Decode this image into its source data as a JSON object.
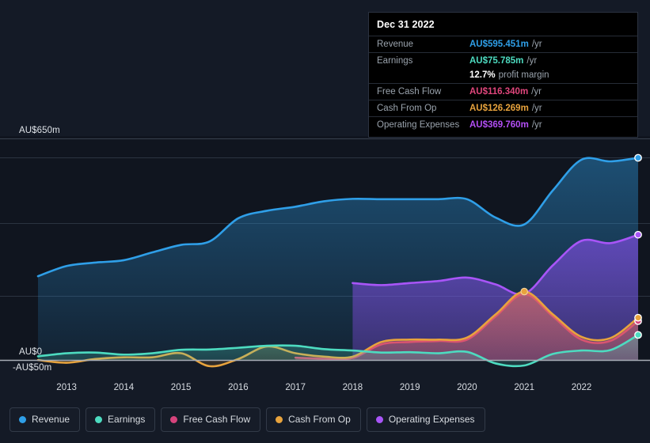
{
  "axis": {
    "top_label": "AU$650m",
    "zero_label": "AU$0",
    "negative_label": "-AU$50m",
    "years": [
      "2013",
      "2014",
      "2015",
      "2016",
      "2017",
      "2018",
      "2019",
      "2020",
      "2021",
      "2022"
    ]
  },
  "tooltip": {
    "date": "Dec 31 2022",
    "unit": "/yr",
    "rows": [
      {
        "key": "Revenue",
        "value": "AU$595.451m",
        "color": "#2f9fe8"
      },
      {
        "key": "Earnings",
        "value": "AU$75.785m",
        "color": "#4ddbc0"
      },
      {
        "key": "Free Cash Flow",
        "value": "AU$116.340m",
        "color": "#e0467c"
      },
      {
        "key": "Cash From Op",
        "value": "AU$126.269m",
        "color": "#e8a33d"
      },
      {
        "key": "Operating Expenses",
        "value": "AU$369.760m",
        "color": "#b34ef5"
      }
    ],
    "profit_margin_value": "12.7%",
    "profit_margin_label": "profit margin"
  },
  "legend": {
    "items": [
      {
        "label": "Revenue",
        "color": "#2f9fe8"
      },
      {
        "label": "Earnings",
        "color": "#4ddbc0"
      },
      {
        "label": "Free Cash Flow",
        "color": "#d6437c"
      },
      {
        "label": "Cash From Op",
        "color": "#e8a33d"
      },
      {
        "label": "Operating Expenses",
        "color": "#a855f7"
      }
    ]
  },
  "chart_data": {
    "type": "area",
    "title": "",
    "xlabel": "",
    "ylabel": "AU$",
    "ylim": [
      -50,
      650
    ],
    "grid": true,
    "legend_position": "bottom",
    "x_tick_labels": [
      "2013",
      "2014",
      "2015",
      "2016",
      "2017",
      "2018",
      "2019",
      "2020",
      "2021",
      "2022"
    ],
    "y_tick_labels": [
      "AU$650m",
      "AU$0",
      "-AU$50m"
    ],
    "currency": "AU$",
    "units": "millions per year",
    "series": [
      {
        "name": "Revenue",
        "color": "#2f9fe8",
        "x": [
          2012.5,
          2013,
          2013.5,
          2014,
          2014.5,
          2015,
          2015.5,
          2016,
          2016.5,
          2017,
          2017.5,
          2018,
          2018.5,
          2019,
          2019.5,
          2020,
          2020.5,
          2021,
          2021.5,
          2022,
          2022.5,
          2022.99
        ],
        "values": [
          248,
          278,
          288,
          295,
          318,
          340,
          350,
          418,
          440,
          452,
          468,
          475,
          474,
          474,
          474,
          474,
          420,
          400,
          500,
          590,
          585,
          595.451
        ]
      },
      {
        "name": "Earnings",
        "color": "#4ddbc0",
        "x": [
          2012.5,
          2013,
          2013.5,
          2014,
          2014.5,
          2015,
          2015.5,
          2016,
          2016.5,
          2017,
          2017.5,
          2018,
          2018.5,
          2019,
          2019.5,
          2020,
          2020.5,
          2021,
          2021.5,
          2022,
          2022.5,
          2022.99
        ],
        "values": [
          13,
          22,
          24,
          18,
          22,
          32,
          33,
          38,
          44,
          44,
          34,
          30,
          24,
          25,
          22,
          26,
          -8,
          -14,
          20,
          30,
          31,
          75.785
        ]
      },
      {
        "name": "Free Cash Flow",
        "color": "#d6437c",
        "x": [
          2017,
          2017.5,
          2018,
          2018.5,
          2019,
          2019.5,
          2020,
          2020.5,
          2021,
          2021.5,
          2022,
          2022.5,
          2022.99
        ],
        "values": [
          9,
          6,
          8,
          48,
          55,
          58,
          62,
          130,
          196,
          130,
          62,
          58,
          116.34
        ]
      },
      {
        "name": "Cash From Op",
        "color": "#e8a33d",
        "x": [
          2012.5,
          2013,
          2013.5,
          2014,
          2014.5,
          2015,
          2015.5,
          2016,
          2016.5,
          2017,
          2017.5,
          2018,
          2018.5,
          2019,
          2019.5,
          2020,
          2020.5,
          2021,
          2021.5,
          2022,
          2022.5,
          2022.99
        ],
        "values": [
          2,
          -6,
          5,
          10,
          10,
          22,
          -16,
          5,
          42,
          22,
          12,
          12,
          55,
          62,
          62,
          68,
          136,
          203,
          136,
          70,
          66,
          126.269
        ]
      },
      {
        "name": "Operating Expenses",
        "color": "#a855f7",
        "x": [
          2018,
          2018.5,
          2019,
          2019.5,
          2020,
          2020.5,
          2021,
          2021.5,
          2022,
          2022.5,
          2022.99
        ],
        "values": [
          228,
          222,
          228,
          234,
          244,
          224,
          196,
          280,
          352,
          345,
          369.76
        ]
      }
    ]
  }
}
